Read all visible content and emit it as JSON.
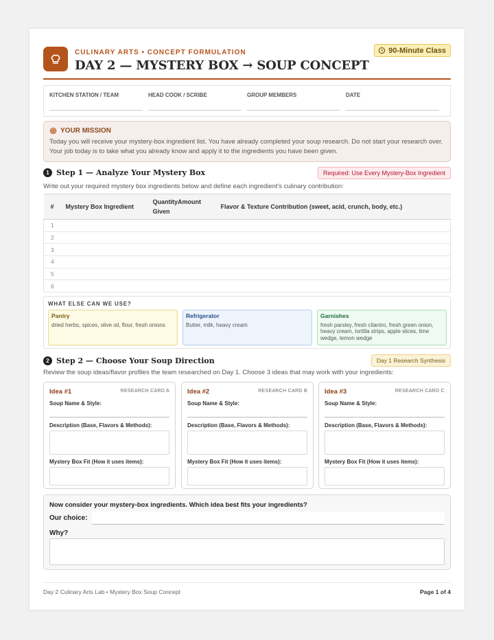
{
  "header": {
    "kicker": "CULINARY ARTS • CONCEPT FORMULATION",
    "title": "DAY 2 — MYSTERY BOX → SOUP CONCEPT",
    "duration": "90-Minute Class",
    "icon": "chef-hat-icon"
  },
  "meta": {
    "fields": [
      "KITCHEN STATION / TEAM",
      "HEAD COOK / SCRIBE",
      "GROUP MEMBERS",
      "DATE"
    ]
  },
  "mission": {
    "heading": "YOUR MISSION",
    "text": "Today you will receive your mystery-box ingredient list. You have already completed your soup research. Do not start your research over. Your job today is to take what you already know and apply it to the ingredients you have been given."
  },
  "step1": {
    "num": "1",
    "title": "Step 1 — Analyze Your Mystery Box",
    "tag": "Required: Use Every Mystery-Box Ingredient",
    "instruction": "Write out your required mystery box ingredients below and define each ingredient's culinary contribution:",
    "columns": [
      "#",
      "Mystery Box Ingredient",
      "QuantityAmount Given",
      "Flavor & Texture Contribution (sweet, acid, crunch, body, etc.)"
    ],
    "rows": [
      "1",
      "2",
      "3",
      "4",
      "5",
      "6"
    ]
  },
  "use": {
    "title": "WHAT ELSE CAN WE USE?",
    "cards": [
      {
        "name": "Pantry",
        "items": "dried herbs, spices, olive oil, flour, fresh onions"
      },
      {
        "name": "Refrigerator",
        "items": "Butter, milk, heavy cream"
      },
      {
        "name": "Garnishes",
        "items": "fresh parsley, fresh cilantro, fresh green onion, heavy cream, tortilla strips, apple slices, lime wedge, lemon wedge"
      }
    ]
  },
  "step2": {
    "num": "2",
    "title": "Step 2 — Choose Your Soup Direction",
    "tag": "Day 1 Research Synthesis",
    "instruction": "Review the soup ideas/flavor profiles the team researched on Day 1. Choose 3 ideas that may work with your ingredients:",
    "ideas": [
      {
        "title": "Idea #1",
        "card": "RESEARCH CARD A"
      },
      {
        "title": "Idea #2",
        "card": "RESEARCH CARD B"
      },
      {
        "title": "Idea #3",
        "card": "RESEARCH CARD C"
      }
    ],
    "labels": {
      "name": "Soup Name & Style:",
      "desc": "Description (Base, Flavors & Methods):",
      "fit": "Mystery Box Fit (How it uses items):"
    }
  },
  "choice": {
    "question": "Now consider your mystery-box ingredients. Which idea best fits your ingredients?",
    "our_choice": "Our choice:",
    "why": "Why?"
  },
  "footer": {
    "left": "Day 2 Culinary Arts Lab • Mystery Box Soup Concept",
    "page": "Page 1 of 4"
  }
}
